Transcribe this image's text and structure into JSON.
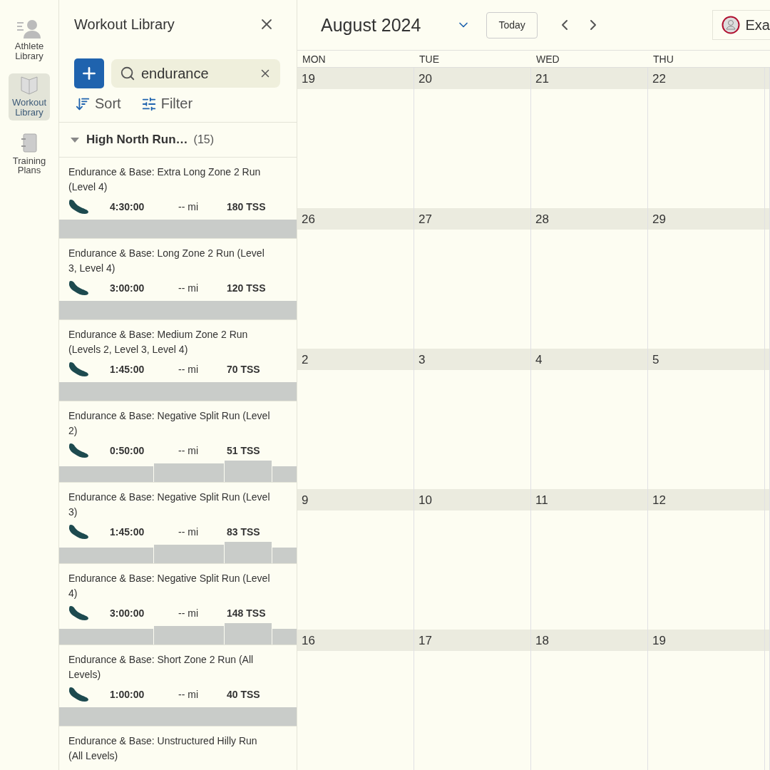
{
  "nav": [
    {
      "label": "Athlete Library",
      "selected": false
    },
    {
      "label": "Workout Library",
      "selected": true
    },
    {
      "label": "Training Plans",
      "selected": false
    }
  ],
  "library": {
    "title": "Workout Library",
    "search": {
      "value": "endurance"
    },
    "sort": "Sort",
    "filter": "Filter",
    "group": {
      "name": "High North Run…",
      "count": "(15)",
      "expanded": true
    },
    "workouts": [
      {
        "title": "Endurance & Base: Extra Long Zone 2 Run (Level 4)",
        "duration": "4:30:00",
        "distance": "-- mi",
        "tss": "180 TSS",
        "kind": "steady"
      },
      {
        "title": "Endurance & Base: Long Zone 2 Run (Level 3, Level 4)",
        "duration": "3:00:00",
        "distance": "-- mi",
        "tss": "120 TSS",
        "kind": "steady"
      },
      {
        "title": "Endurance & Base: Medium Zone 2 Run (Levels 2, Level 3, Level 4)",
        "duration": "1:45:00",
        "distance": "-- mi",
        "tss": "70 TSS",
        "kind": "steady"
      },
      {
        "title": "Endurance & Base: Negative Split Run (Level 2)",
        "duration": "0:50:00",
        "distance": "-- mi",
        "tss": "51 TSS",
        "kind": "split"
      },
      {
        "title": "Endurance & Base: Negative Split Run (Level 3)",
        "duration": "1:45:00",
        "distance": "-- mi",
        "tss": "83 TSS",
        "kind": "split"
      },
      {
        "title": "Endurance & Base: Negative Split Run (Level 4)",
        "duration": "3:00:00",
        "distance": "-- mi",
        "tss": "148 TSS",
        "kind": "split"
      },
      {
        "title": "Endurance & Base: Short Zone 2 Run (All Levels)",
        "duration": "1:00:00",
        "distance": "-- mi",
        "tss": "40 TSS",
        "kind": "steady"
      },
      {
        "title": "Endurance & Base: Unstructured Hilly Run (All Levels)",
        "kind": "none"
      }
    ]
  },
  "calendar": {
    "month": "August 2024",
    "today": "Today",
    "user": "Exa",
    "days": [
      "MON",
      "TUE",
      "WED",
      "THU"
    ],
    "weeks": [
      [
        "19",
        "20",
        "21",
        "22"
      ],
      [
        "26",
        "27",
        "28",
        "29"
      ],
      [
        "2",
        "3",
        "4",
        "5"
      ],
      [
        "9",
        "10",
        "11",
        "12"
      ],
      [
        "16",
        "17",
        "18",
        "19"
      ]
    ]
  }
}
